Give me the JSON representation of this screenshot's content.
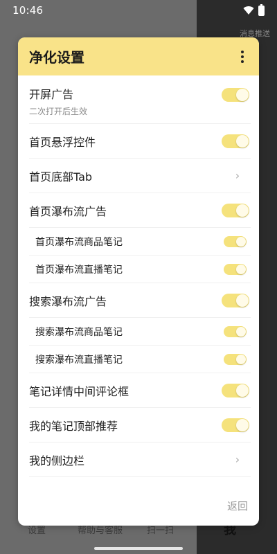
{
  "statusbar": {
    "time": "10:46",
    "wifi_icon": "wifi-icon",
    "battery_icon": "battery-charging-icon"
  },
  "background": {
    "top_right_text": "消息推送",
    "tabs": [
      "设置",
      "帮助与客服",
      "扫一扫",
      "我"
    ]
  },
  "dialog": {
    "title": "净化设置",
    "more_icon": "more-vertical-icon",
    "items": [
      {
        "label": "开屏广告",
        "sublabel": "二次打开后生效",
        "control": "toggle",
        "on": true
      },
      {
        "label": "首页悬浮控件",
        "control": "toggle",
        "on": true
      },
      {
        "label": "首页底部Tab",
        "control": "chevron"
      },
      {
        "label": "首页瀑布流广告",
        "control": "toggle",
        "on": true
      },
      {
        "label": "首页瀑布流商品笔记",
        "control": "toggle",
        "on": true,
        "sub": true
      },
      {
        "label": "首页瀑布流直播笔记",
        "control": "toggle",
        "on": true,
        "sub": true
      },
      {
        "label": "搜索瀑布流广告",
        "control": "toggle",
        "on": true
      },
      {
        "label": "搜索瀑布流商品笔记",
        "control": "toggle",
        "on": true,
        "sub": true
      },
      {
        "label": "搜索瀑布流直播笔记",
        "control": "toggle",
        "on": true,
        "sub": true
      },
      {
        "label": "笔记详情中间评论框",
        "control": "toggle",
        "on": true
      },
      {
        "label": "我的笔记顶部推荐",
        "control": "toggle",
        "on": true
      },
      {
        "label": "我的侧边栏",
        "control": "chevron"
      }
    ],
    "back_label": "返回"
  },
  "colors": {
    "header_bg": "#f9e389",
    "toggle_on": "#f5e27c"
  }
}
